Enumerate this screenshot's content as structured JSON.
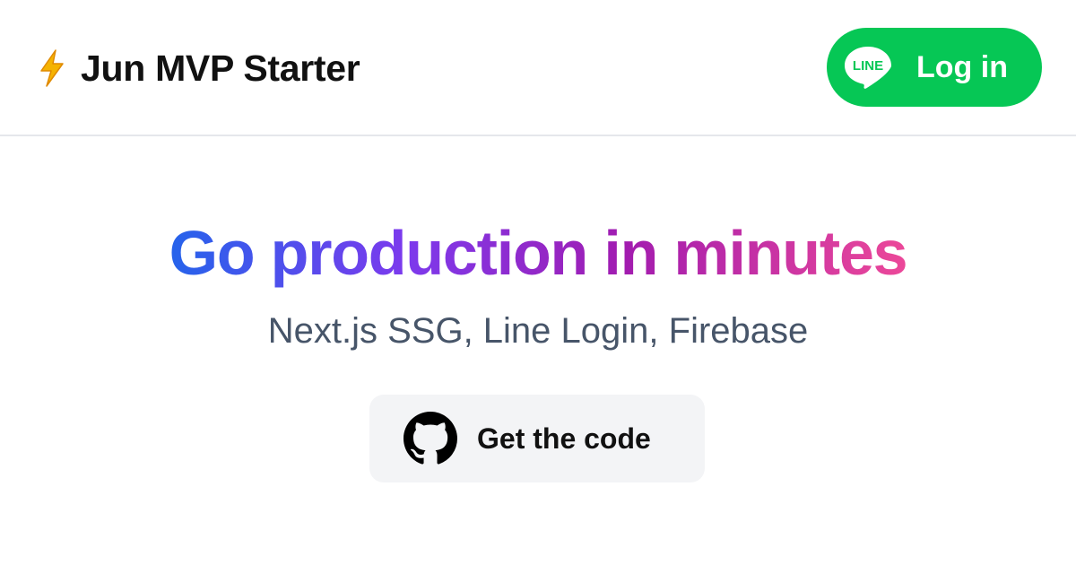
{
  "header": {
    "brand_title": "Jun MVP Starter",
    "brand_icon": "lightning-bolt-icon",
    "login_button": {
      "icon": "line-icon",
      "icon_text": "LINE",
      "label": "Log in",
      "color": "#06c755"
    }
  },
  "hero": {
    "title": "Go production in minutes",
    "title_gradient": [
      "#2563eb",
      "#7c3aed",
      "#a21caf",
      "#ec4899"
    ],
    "subtitle": "Next.js SSG, Line Login, Firebase",
    "cta_button": {
      "icon": "github-icon",
      "label": "Get the code"
    }
  }
}
